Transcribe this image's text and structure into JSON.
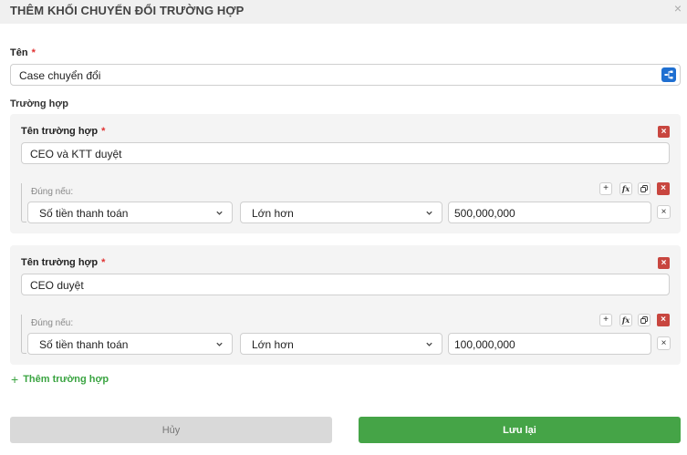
{
  "dialog": {
    "title": "THÊM KHỐI CHUYỂN ĐỔI TRƯỜNG HỢP",
    "close_glyph": "×"
  },
  "required_mark": "*",
  "name_field": {
    "label": "Tên",
    "value": "Case chuyển đổi"
  },
  "cases_section_label": "Trường hợp",
  "cases": [
    {
      "label": "Tên trường hợp",
      "value": "CEO và KTT duyệt",
      "condition_label": "Đúng nếu:",
      "condition": {
        "field": "Số tiền thanh toán",
        "operator": "Lớn hơn",
        "value": "500,000,000"
      }
    },
    {
      "label": "Tên trường hợp",
      "value": "CEO duyệt",
      "condition_label": "Đúng nếu:",
      "condition": {
        "field": "Số tiền thanh toán",
        "operator": "Lớn hơn",
        "value": "100,000,000"
      }
    }
  ],
  "icons": {
    "delete": "x-icon",
    "add": "plus-icon",
    "formula": "fx-icon",
    "copy": "copy-icon",
    "flow": "flow-icon",
    "chevron": "chevron-down-icon"
  },
  "glyphs": {
    "x": "×",
    "plus": "+",
    "fx": "fx"
  },
  "add_case_label": "Thêm trường hợp",
  "buttons": {
    "cancel": "Hủy",
    "save": "Lưu lại"
  },
  "colors": {
    "primary_green": "#45a447",
    "danger_red": "#c8463f",
    "flow_blue": "#1f6fd1",
    "required_red": "#e03131"
  }
}
